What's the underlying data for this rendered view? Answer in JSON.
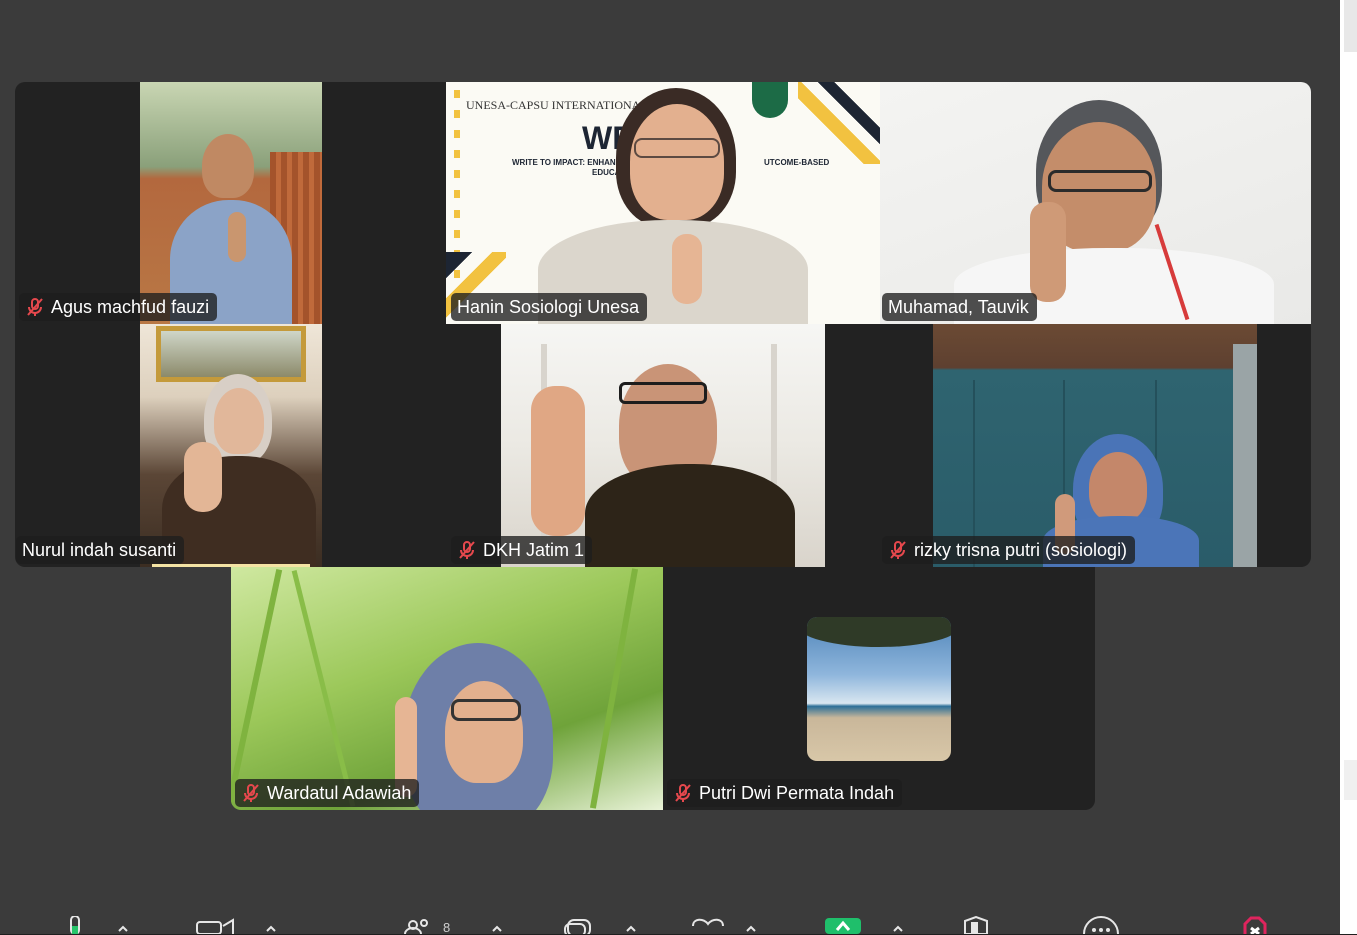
{
  "participants": {
    "p1": {
      "name": "Agus machfud fauzi",
      "muted": true
    },
    "p2": {
      "name": "Hanin Sosiologi Unesa",
      "muted": false,
      "active_speaker": true,
      "slide_text": {
        "header": "UNESA-CAPSU INTERNATIONAL",
        "big": "WE",
        "line1": "WRITE TO IMPACT: ENHANCING",
        "line1b": "UTCOME-BASED",
        "line2": "EDUCA"
      }
    },
    "p3": {
      "name": "Muhamad, Tauvik",
      "muted": false
    },
    "p4": {
      "name": "Nurul indah susanti",
      "muted": false
    },
    "p5": {
      "name": "DKH Jatim 1",
      "muted": true
    },
    "p6": {
      "name": "rizky trisna putri (sosiologi)",
      "muted": true
    },
    "p7": {
      "name": "Wardatul Adawiah",
      "muted": true
    },
    "p8": {
      "name": "Putri Dwi Permata Indah",
      "muted": true
    }
  },
  "toolbar": {
    "participants_count": "8",
    "icons": [
      "microphone-icon",
      "camera-icon",
      "participants-icon",
      "chat-icon",
      "reactions-icon",
      "share-icon",
      "security-icon",
      "more-icon",
      "end-icon"
    ]
  },
  "colors": {
    "active_border": "#2ed67e",
    "mute_red": "#e5484d",
    "share_green": "#1fbf6b"
  }
}
